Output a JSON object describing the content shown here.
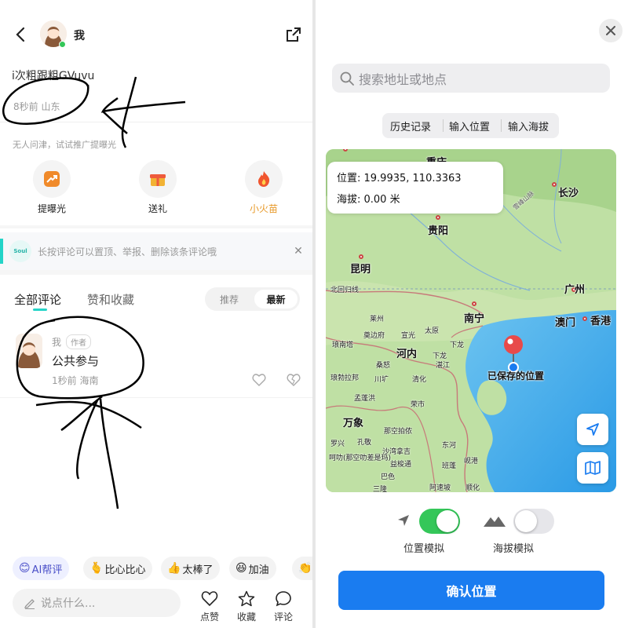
{
  "left": {
    "header": {
      "title": "我"
    },
    "profile": {
      "name": "i次粗跟粗GVuvu",
      "meta": "8秒前 山东",
      "hint": "无人问津，试试推广提曝光"
    },
    "actions": [
      {
        "label": "提曝光",
        "icon": "boost-icon"
      },
      {
        "label": "送礼",
        "icon": "gift-icon"
      },
      {
        "label": "小火苗",
        "icon": "flame-icon"
      }
    ],
    "notice": {
      "badge": "Soul",
      "text": "长按评论可以置顶、举报、删除该条评论哦"
    },
    "tabs": {
      "all_comments": "全部评论",
      "likes_favs": "赞和收藏",
      "sort_recommend": "推荐",
      "sort_latest": "最新"
    },
    "comment": {
      "user": "我",
      "tag": "作者",
      "text": "公共参与",
      "meta": "1秒前 海南"
    },
    "quick_replies": [
      {
        "emoji": "😊",
        "label": "AI帮评"
      },
      {
        "emoji": "🫰",
        "label": "比心比心"
      },
      {
        "emoji": "👍",
        "label": "太棒了"
      },
      {
        "emoji": "😆",
        "label": "加油"
      },
      {
        "emoji": "👏",
        "label": ""
      }
    ],
    "input": {
      "placeholder": "说点什么..."
    },
    "bottom": {
      "like": "点赞",
      "favorite": "收藏",
      "comment": "评论"
    }
  },
  "right": {
    "search": {
      "placeholder": "搜索地址或地点"
    },
    "segments": [
      "历史记录",
      "输入位置",
      "输入海拔"
    ],
    "info": {
      "position": "位置: 19.9935, 110.3363",
      "altitude": "海拔: 0.00 米"
    },
    "map": {
      "pin_label": "已保存的位置",
      "cities": [
        "重庆",
        "长沙",
        "贵阳",
        "昆明",
        "南宁",
        "广州",
        "澳门",
        "香港",
        "河内",
        "海防",
        "万象"
      ],
      "towns": [
        "北回归线",
        "莱州",
        "奠边府",
        "宣光",
        "太原",
        "下龙",
        "琅南塔",
        "桑怒",
        "清化",
        "琅勃拉邦",
        "川圹",
        "孟蓬洪",
        "荣市",
        "那空拍侬",
        "孔敬",
        "沙湾拿吉",
        "益梭通",
        "呵叻(那空叻差是玛)",
        "阿速坡",
        "巴色",
        "岘港",
        "班蓬",
        "东河",
        "顺化",
        "三隆",
        "雪峰山脉",
        "湛江",
        "罗兴"
      ]
    },
    "toggles": {
      "location_label": "位置模拟",
      "altitude_label": "海拔模拟",
      "location_on": true,
      "altitude_on": false
    },
    "confirm": "确认位置"
  },
  "colors": {
    "accent": "#1a7cf0",
    "green": "#34c759",
    "teal": "#25d4c8",
    "orange": "#e89a2a"
  }
}
